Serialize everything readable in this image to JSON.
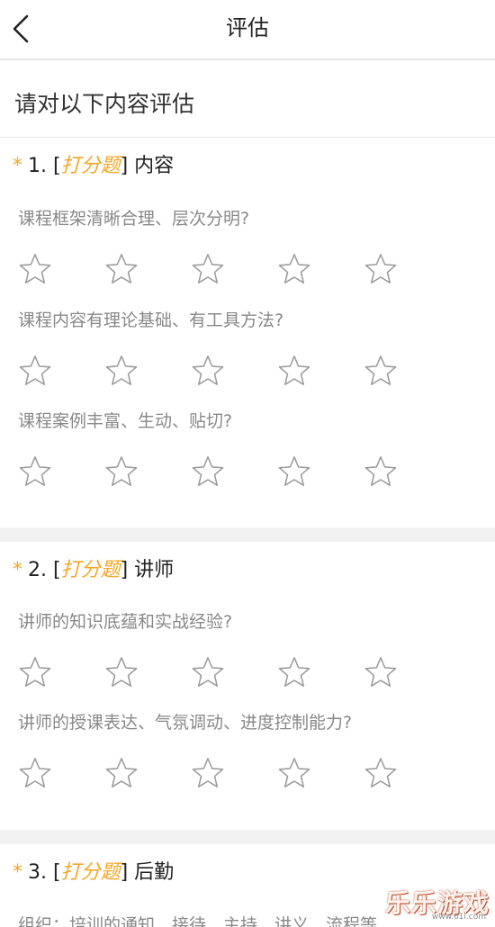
{
  "nav": {
    "title": "评估",
    "back_icon": "chevron-left-icon"
  },
  "intro": {
    "text": "请对以下内容评估"
  },
  "colors": {
    "accent": "#f5a623",
    "star_outline": "#9a9a9a",
    "divider": "#f2f2f2"
  },
  "questions": [
    {
      "number": "1.",
      "tag": "打分题",
      "title": "内容",
      "items": [
        {
          "text": "课程框架清晰合理、层次分明?",
          "rating": 0,
          "max": 5
        },
        {
          "text": "课程内容有理论基础、有工具方法?",
          "rating": 0,
          "max": 5
        },
        {
          "text": "课程案例丰富、生动、贴切?",
          "rating": 0,
          "max": 5
        }
      ]
    },
    {
      "number": "2.",
      "tag": "打分题",
      "title": "讲师",
      "items": [
        {
          "text": "讲师的知识底蕴和实战经验?",
          "rating": 0,
          "max": 5
        },
        {
          "text": "讲师的授课表达、气氛调动、进度控制能力?",
          "rating": 0,
          "max": 5
        }
      ]
    },
    {
      "number": "3.",
      "tag": "打分题",
      "title": "后勤",
      "items": [
        {
          "text": "组织：培训的通知、接待、主持、讲义、流程等",
          "rating": 0,
          "max": 5
        }
      ]
    }
  ],
  "watermark": {
    "text": "乐乐游戏",
    "url": "www.61l.com"
  }
}
